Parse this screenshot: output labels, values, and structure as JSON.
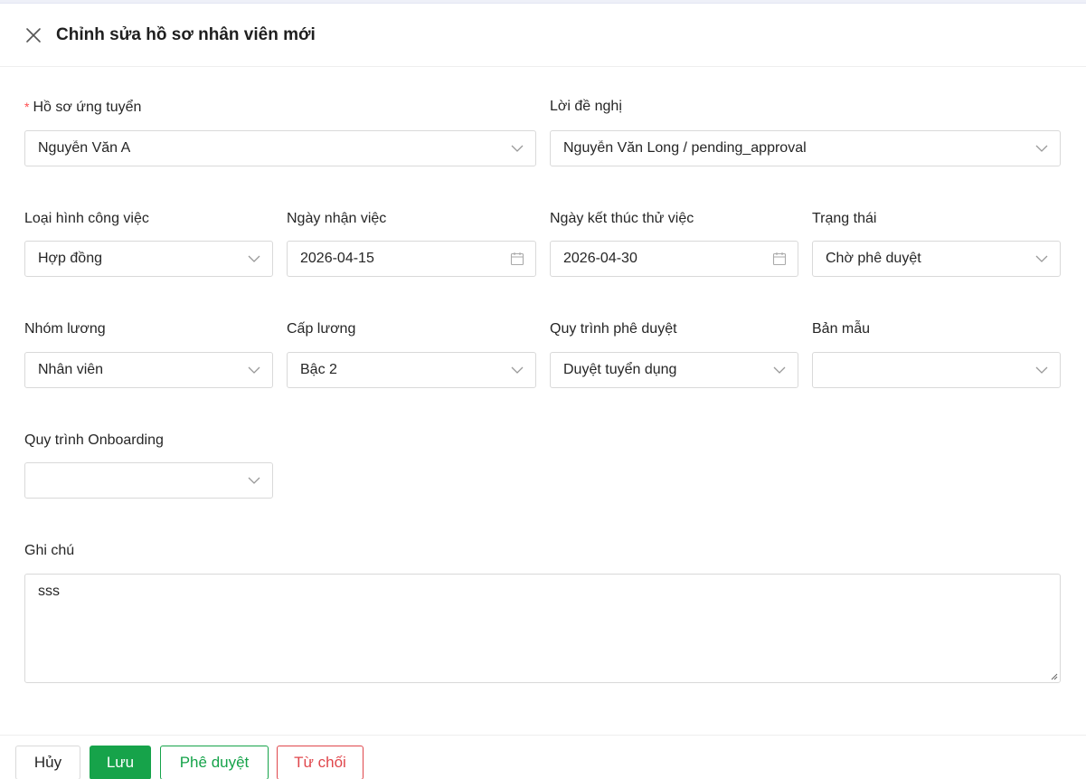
{
  "header": {
    "title": "Chỉnh sửa hồ sơ nhân viên mới",
    "close_icon": "close-icon"
  },
  "form": {
    "candidate_profile": {
      "label": "Hồ sơ ứng tuyển",
      "required": true,
      "value": "Nguyễn Văn A"
    },
    "offer": {
      "label": "Lời đề nghị",
      "value": "Nguyễn Văn Long / pending_approval"
    },
    "job_type": {
      "label": "Loại hình công việc",
      "value": "Hợp đồng"
    },
    "start_date": {
      "label": "Ngày nhận việc",
      "value": "2026-04-15"
    },
    "probation_end": {
      "label": "Ngày kết thúc thử việc",
      "value": "2026-04-30"
    },
    "status": {
      "label": "Trạng thái",
      "value": "Chờ phê duyệt"
    },
    "salary_group": {
      "label": "Nhóm lương",
      "value": "Nhân viên"
    },
    "salary_level": {
      "label": "Cấp lương",
      "value": "Bậc 2"
    },
    "approval_process": {
      "label": "Quy trình phê duyệt",
      "value": "Duyệt tuyển dụng"
    },
    "template": {
      "label": "Bản mẫu",
      "value": ""
    },
    "onboarding_process": {
      "label": "Quy trình Onboarding",
      "value": ""
    },
    "notes": {
      "label": "Ghi chú",
      "value": "sss"
    }
  },
  "footer": {
    "cancel_label": "Hủy",
    "save_label": "Lưu",
    "approve_label": "Phê duyệt",
    "reject_label": "Từ chối"
  },
  "colors": {
    "primary_green": "#16a34a",
    "danger_red": "#e0474c",
    "required_star": "#ff4d4f",
    "border": "#d9d9d9"
  }
}
